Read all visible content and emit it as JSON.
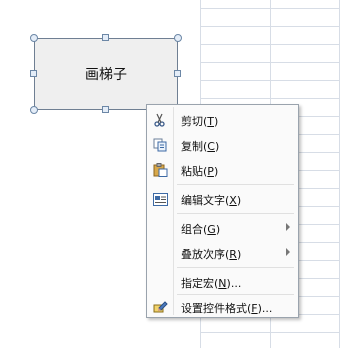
{
  "shape": {
    "label": "画梯子"
  },
  "context_menu": {
    "items": [
      {
        "label": "剪切(",
        "key": "T",
        "tail": ")",
        "icon": "scissors-icon"
      },
      {
        "label": "复制(",
        "key": "C",
        "tail": ")",
        "icon": "copy-icon"
      },
      {
        "label": "粘贴(",
        "key": "P",
        "tail": ")",
        "icon": "paste-icon"
      },
      {
        "label": "编辑文字(",
        "key": "X",
        "tail": ")",
        "icon": "edit-text-icon"
      },
      {
        "label": "组合(",
        "key": "G",
        "tail": ")",
        "icon": ""
      },
      {
        "label": "叠放次序(",
        "key": "R",
        "tail": ")",
        "icon": ""
      },
      {
        "label": "指定宏(",
        "key": "N",
        "tail": ")...",
        "icon": ""
      },
      {
        "label": "设置控件格式(",
        "key": "F",
        "tail": ")...",
        "icon": "format-control-icon"
      }
    ]
  }
}
